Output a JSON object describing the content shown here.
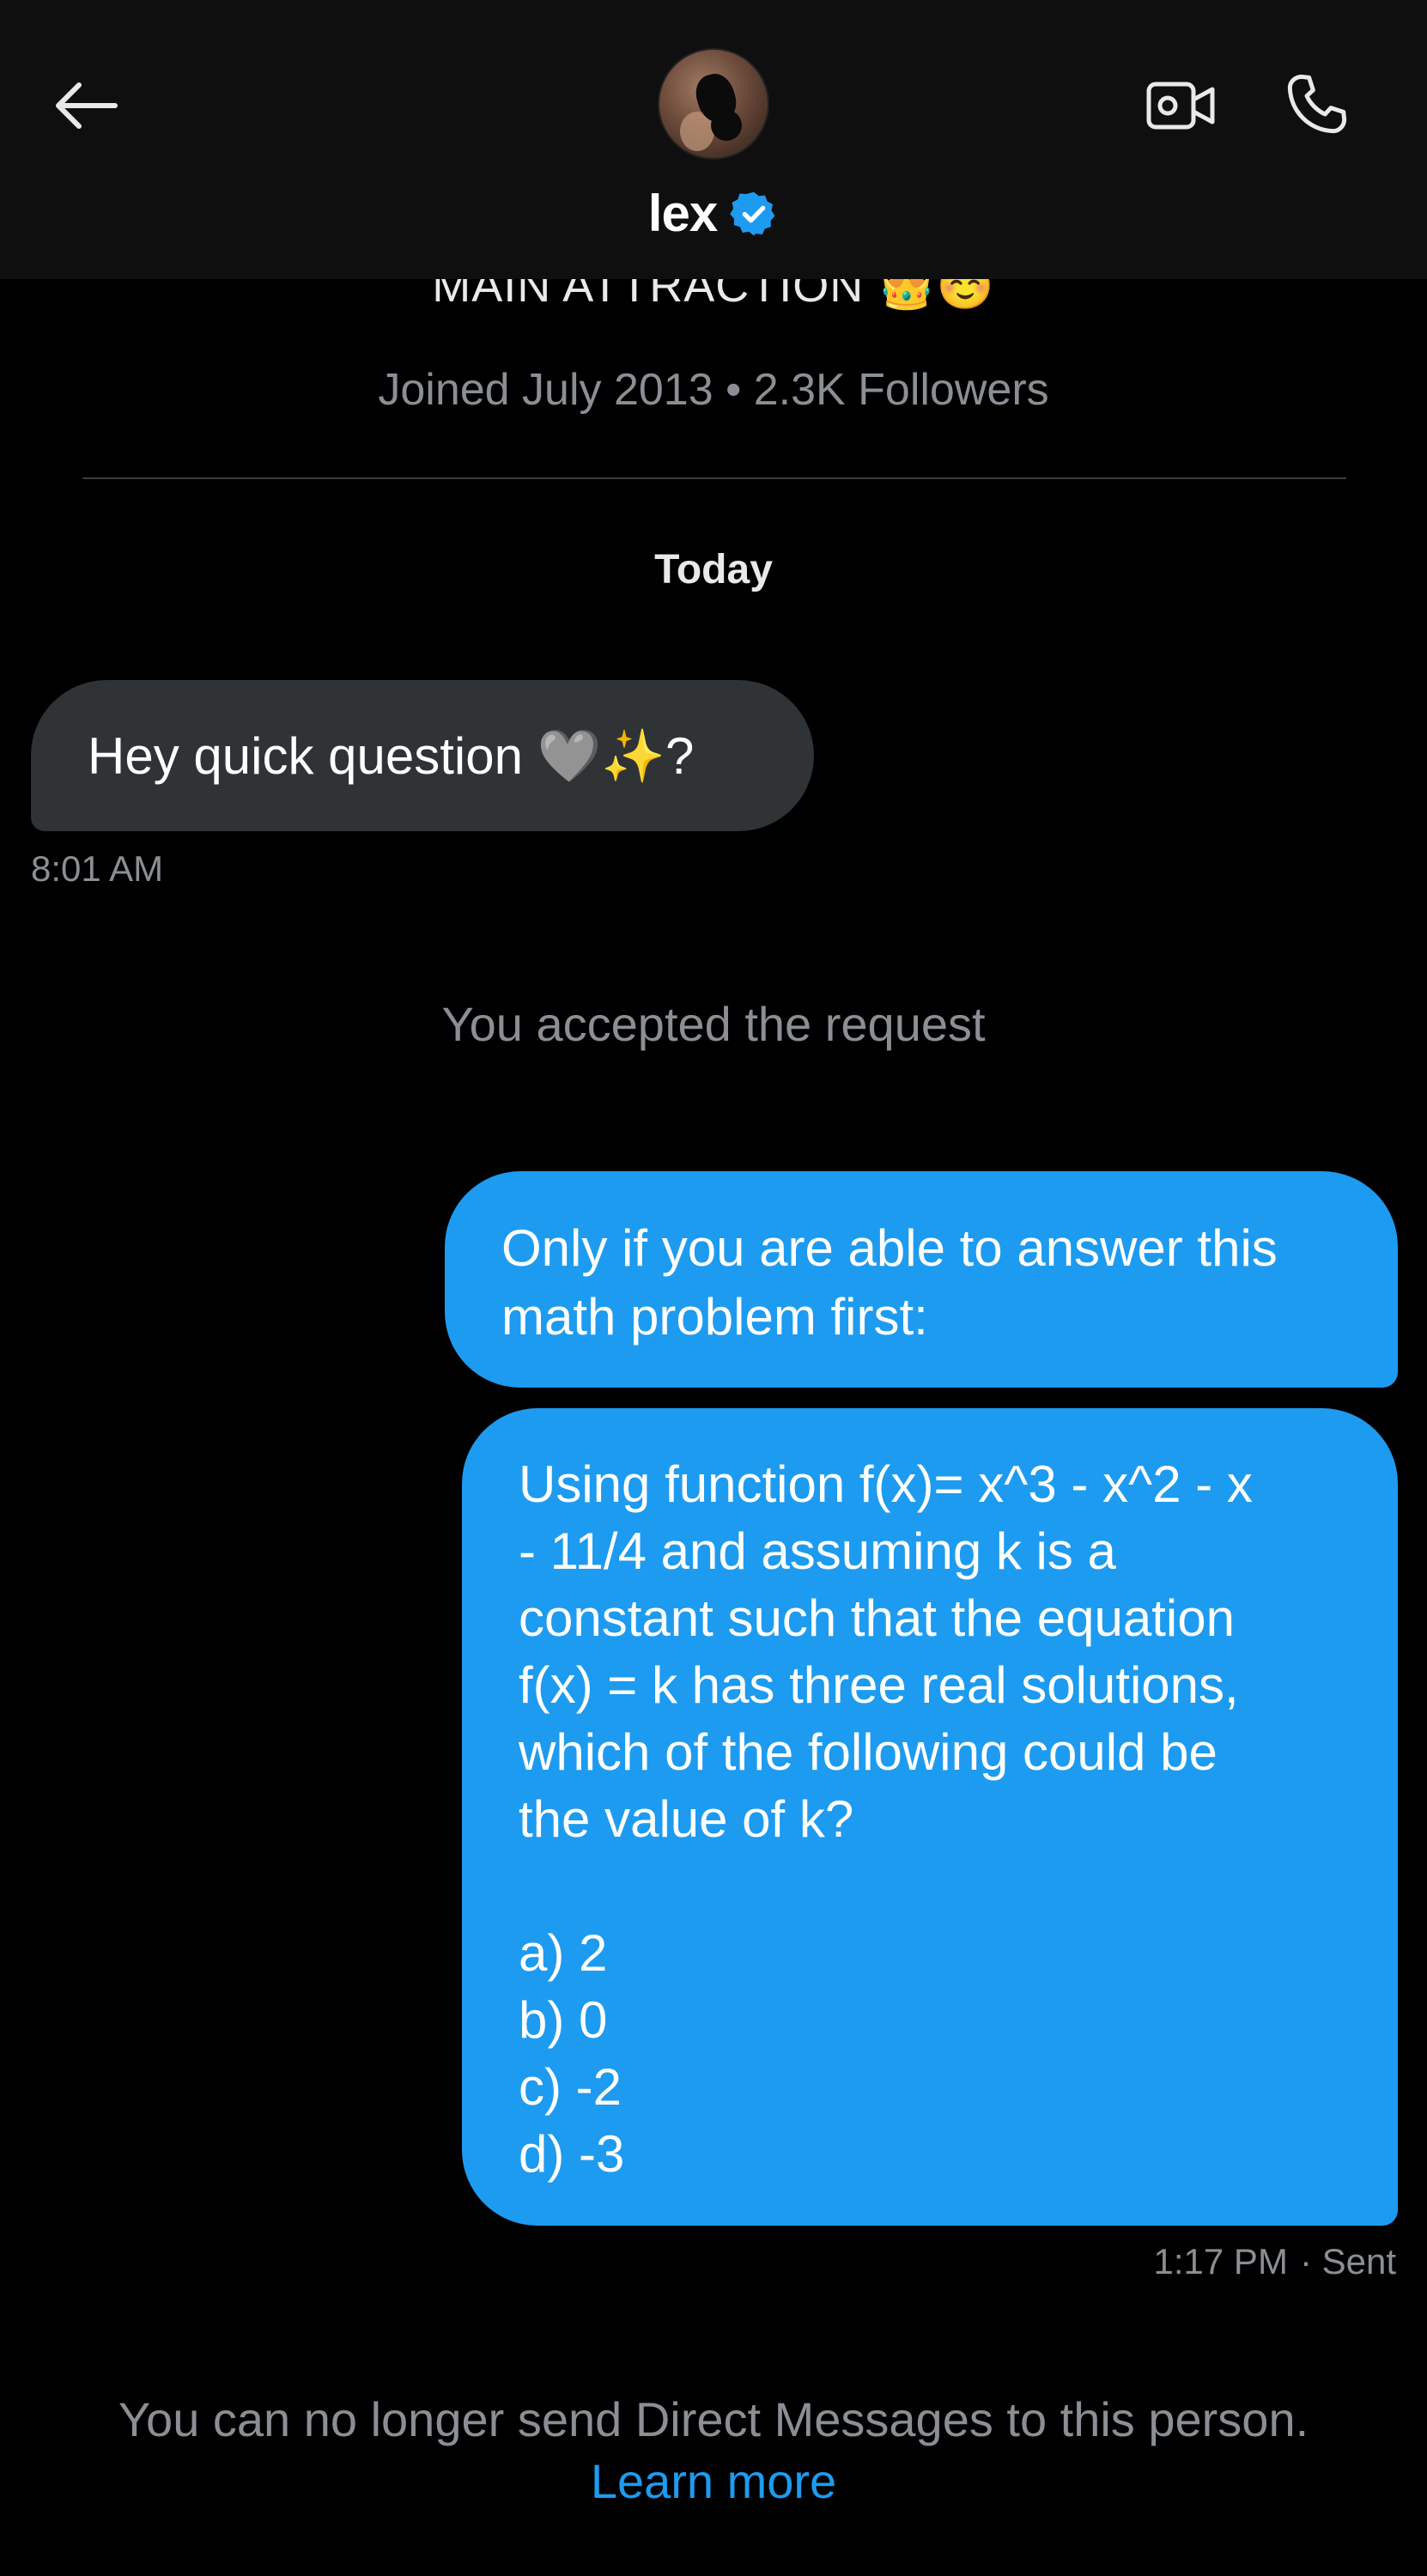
{
  "header": {
    "contact_name": "lex",
    "verified": true,
    "accent_color": "#1d9bf0",
    "icons": [
      "back-arrow-icon",
      "video-camera-icon",
      "phone-icon",
      "verified-badge-icon"
    ]
  },
  "profile": {
    "bio": "MAIN ATTRACTION 👑☺️",
    "joined_line": "Joined July 2013 • 2.3K Followers"
  },
  "conversation": {
    "date_separator": "Today",
    "received": {
      "text": "Hey quick question 🩶✨?",
      "time": "8:01 AM"
    },
    "system_message": "You accepted the request",
    "sent": [
      {
        "text": "Only if you are able to answer this math problem first:"
      },
      {
        "lines": [
          "Using function f(x)= x^3 - x^2 - x",
          "- 11/4 and assuming k is a",
          "constant such that the equation",
          "f(x) = k has three real solutions,",
          "which of the following could be",
          "the value of k?"
        ],
        "options": [
          "a) 2",
          "b) 0",
          "c) -2",
          "d) -3"
        ]
      }
    ],
    "sent_time": "1:17 PM",
    "sent_status": "· Sent"
  },
  "footer": {
    "notice": "You can no longer send Direct Messages to this person.",
    "link": "Learn more"
  }
}
